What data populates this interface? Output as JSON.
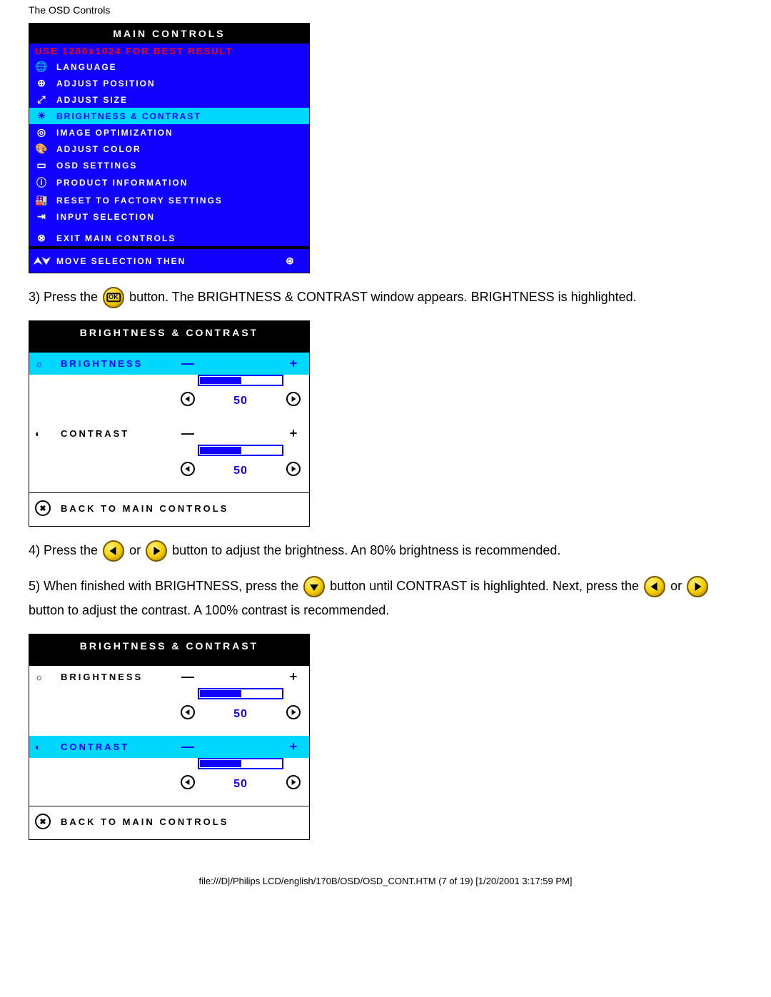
{
  "header": "The OSD Controls",
  "osd": {
    "title": "MAIN CONTROLS",
    "hint": "USE 1280x1024 FOR BEST RESULT",
    "items": [
      {
        "icon": "🌐",
        "label": "LANGUAGE"
      },
      {
        "icon": "⊕",
        "label": "ADJUST POSITION"
      },
      {
        "icon": "⤢",
        "label": "ADJUST SIZE"
      },
      {
        "icon": "☀",
        "label": "BRIGHTNESS & CONTRAST"
      },
      {
        "icon": "◎",
        "label": "IMAGE OPTIMIZATION"
      },
      {
        "icon": "🎨",
        "label": "ADJUST COLOR"
      },
      {
        "icon": "▭",
        "label": "OSD SETTINGS"
      },
      {
        "icon": "ⓘ",
        "label": "PRODUCT INFORMATION"
      },
      {
        "icon": "🏭",
        "label": "RESET TO FACTORY SETTINGS"
      },
      {
        "icon": "⇥",
        "label": "INPUT SELECTION"
      },
      {
        "icon": "⊗",
        "label": "EXIT MAIN CONTROLS"
      }
    ],
    "footer": "MOVE SELECTION THEN",
    "footer_icon_l": "⮝⮟",
    "footer_icon_r": "⊛"
  },
  "step3_a": "3) Press the ",
  "step3_b": " button. The BRIGHTNESS & CONTRAST window appears. BRIGHTNESS is highlighted.",
  "step4_a": "4) Press the ",
  "step4_b": " or ",
  "step4_c": " button to adjust the brightness. An 80% brightness is recommended.",
  "step5_a": "5) When finished with BRIGHTNESS, press the ",
  "step5_b": " button until CONTRAST is highlighted. Next, press the ",
  "step5_c": " or ",
  "step5_d": " button to adjust the contrast. A 100% contrast is recommended.",
  "bc": {
    "title": "BRIGHTNESS & CONTRAST",
    "brightness_icon": "☼",
    "brightness": "BRIGHTNESS",
    "minus": "—",
    "plus": "+",
    "brightness_val": "50",
    "contrast_icon": "◐",
    "contrast": "CONTRAST",
    "contrast_val": "50",
    "back": "BACK TO MAIN CONTROLS",
    "back_icon": "✖"
  },
  "footer": "file:///D|/Philips LCD/english/170B/OSD/OSD_CONT.HTM (7 of 19) [1/20/2001 3:17:59 PM]"
}
